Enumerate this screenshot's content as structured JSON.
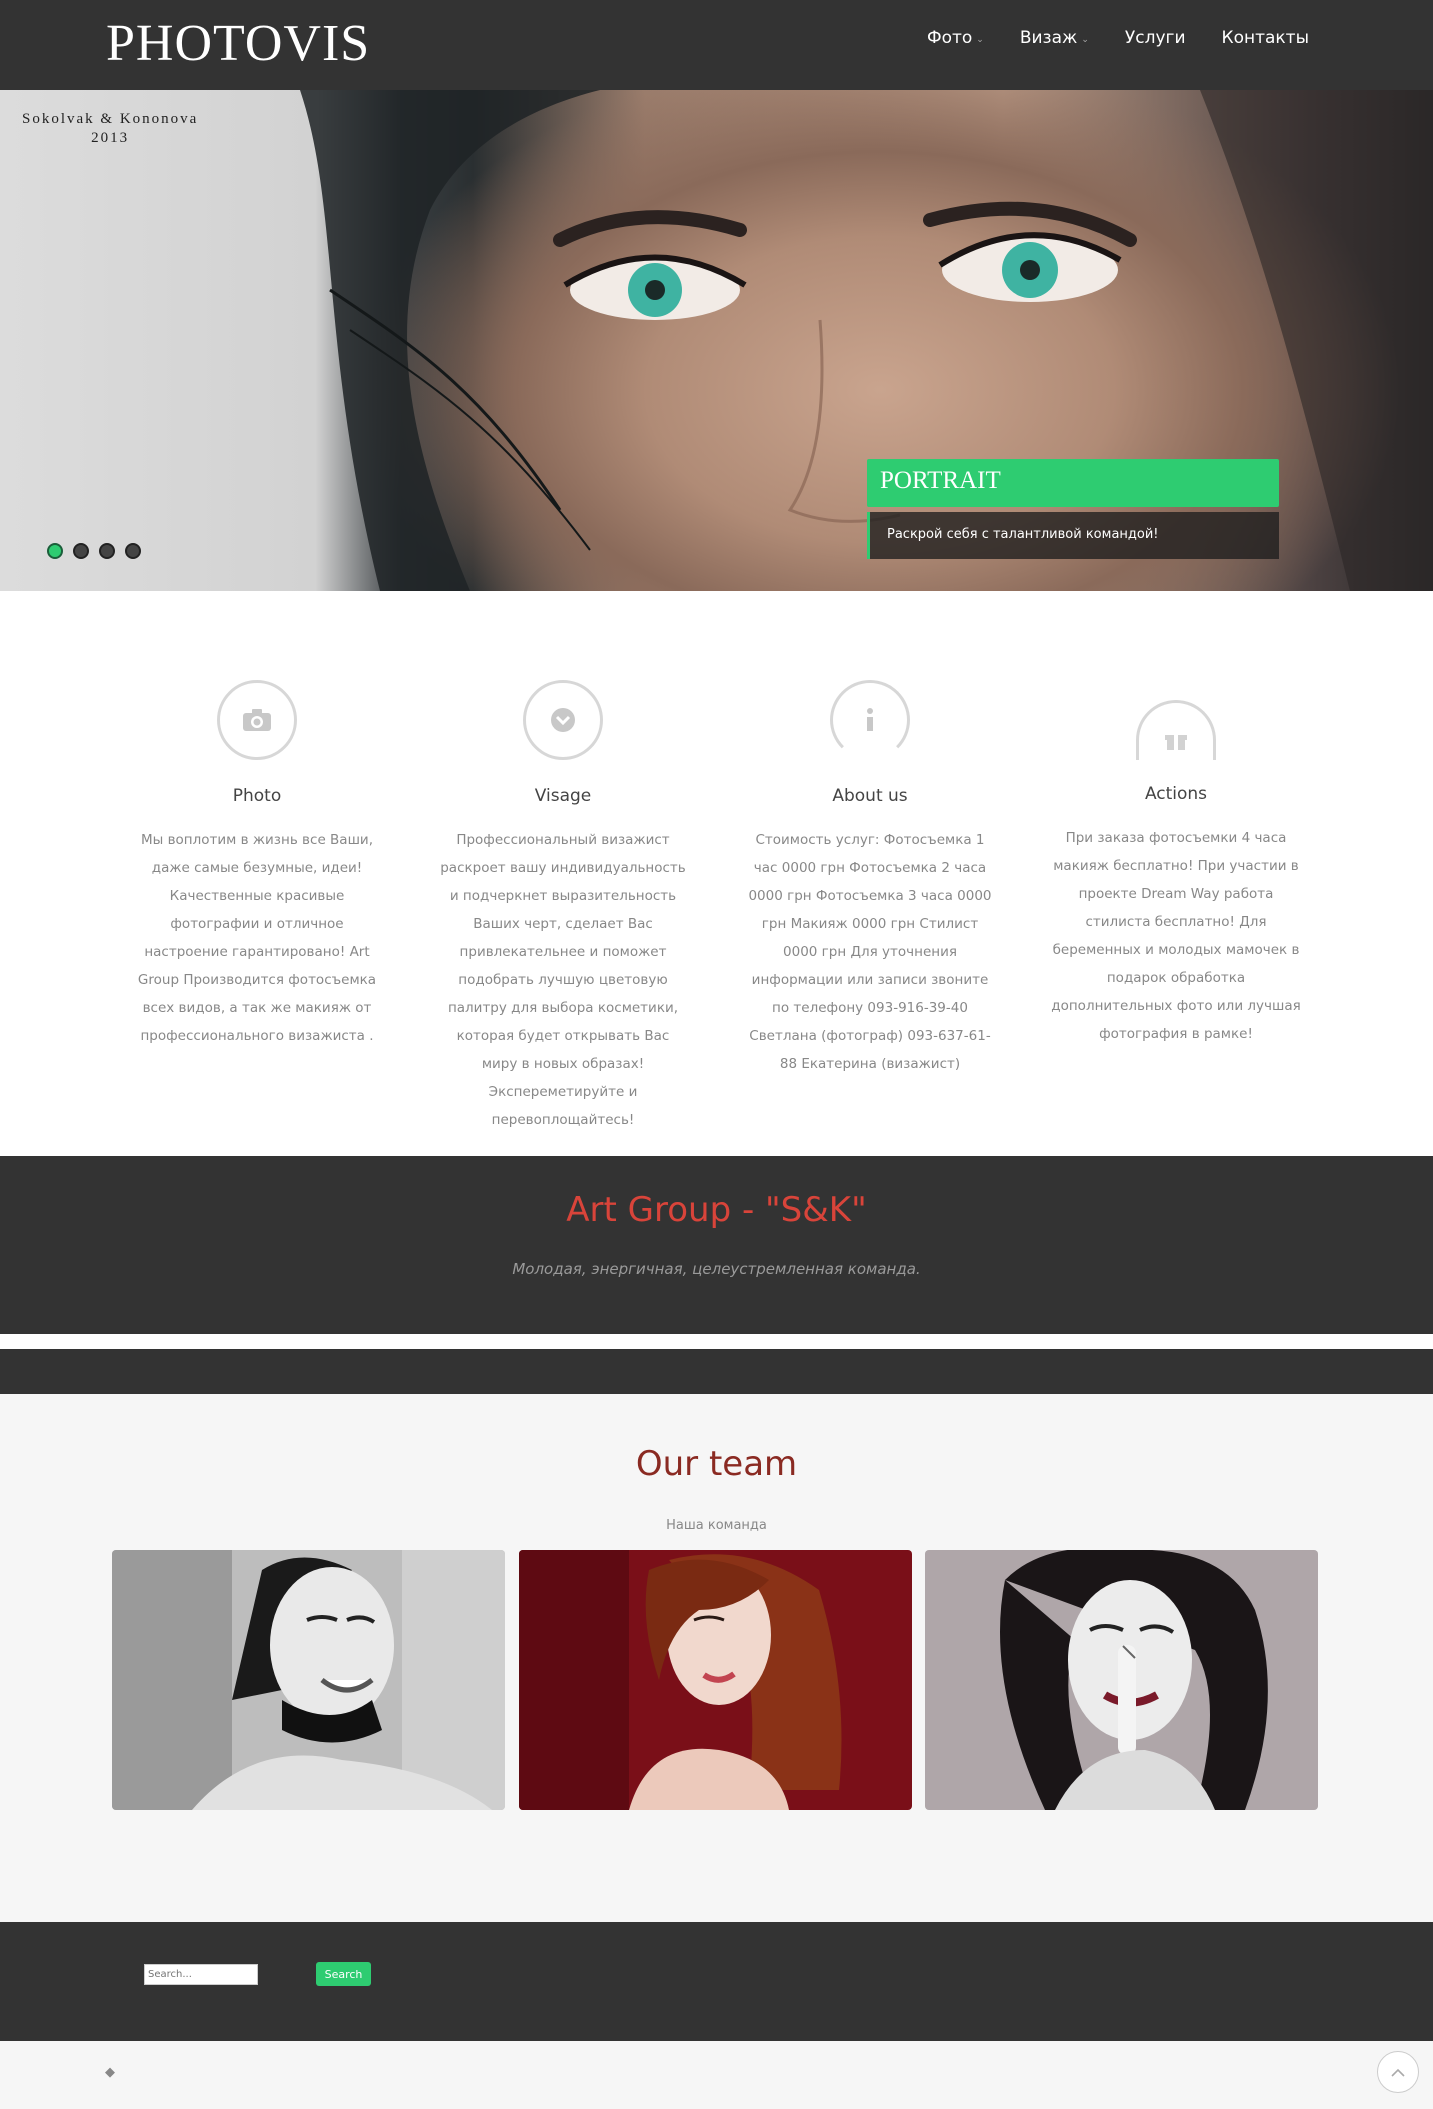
{
  "header": {
    "logo": "PHOTOVIS",
    "nav": [
      {
        "label": "Фото",
        "has_dropdown": true
      },
      {
        "label": "Визаж",
        "has_dropdown": true
      },
      {
        "label": "Услуги",
        "has_dropdown": false
      },
      {
        "label": "Контакты",
        "has_dropdown": false
      }
    ]
  },
  "hero": {
    "caption_line1": "Sokolvak & Kononova",
    "caption_line2": "2013",
    "slide_title": "PORTRAIT",
    "slide_subtitle": "Раскрой себя с талантливой командой!",
    "slide_count": 4,
    "active_slide": 1
  },
  "features": [
    {
      "icon": "camera-icon",
      "title": "Photo",
      "text": "Мы воплотим в жизнь все Ваши, даже самые безумные, идеи! Качественные красивые фотографии и отличное настроение гарантировано! Art Group Производится фотосъемка всех видов, а так же макияж от профессионального визажиста ."
    },
    {
      "icon": "chevron-down-icon",
      "title": "Visage",
      "text": "Профессиональный визажист раскроет вашу индивидуальность и подчеркнет выразительность Ваших черт, сделает Вас привлекательнее и поможет подобрать лучшую цветовую палитру для выбора косметики, которая будет открывать Вас миру в новых образах! Экспереметируйте и перевоплощайтесь!"
    },
    {
      "icon": "info-icon",
      "title": "About us",
      "text": "Стоимость услуг: Фотосъемка 1 час 0000 грн Фотосъемка 2 часа 0000 грн Фотосъемка 3 часа 0000 грн Макияж 0000 грн Стилист 0000 грн Для уточнения информации или записи звоните по телефону 093-916-39-40 Светлана (фотограф) 093-637-61-88 Екатерина (визажист)"
    },
    {
      "icon": "gift-icon",
      "title": "Actions",
      "text": "При заказа фотосъемки 4 часа макияж бесплатно! При участии в проекте Dream Way работа стилиста бесплатно! Для беременных и молодых мамочек в подарок обработка дополнительных фото или лучшая фотография в рамке!"
    }
  ],
  "band": {
    "title": "Art Group - \"S&K\"",
    "subtitle": "Молодая, энергичная, целеустремленная команда."
  },
  "team": {
    "title": "Our team",
    "subtitle": "Наша команда",
    "photos": [
      "team-photo-1",
      "team-photo-2",
      "team-photo-3"
    ]
  },
  "footer": {
    "search_placeholder": "Search...",
    "search_button": "Search"
  },
  "colors": {
    "accent": "#2ecc71",
    "dark": "#333333",
    "band_title": "#d9443a",
    "team_title": "#8a2a22"
  }
}
